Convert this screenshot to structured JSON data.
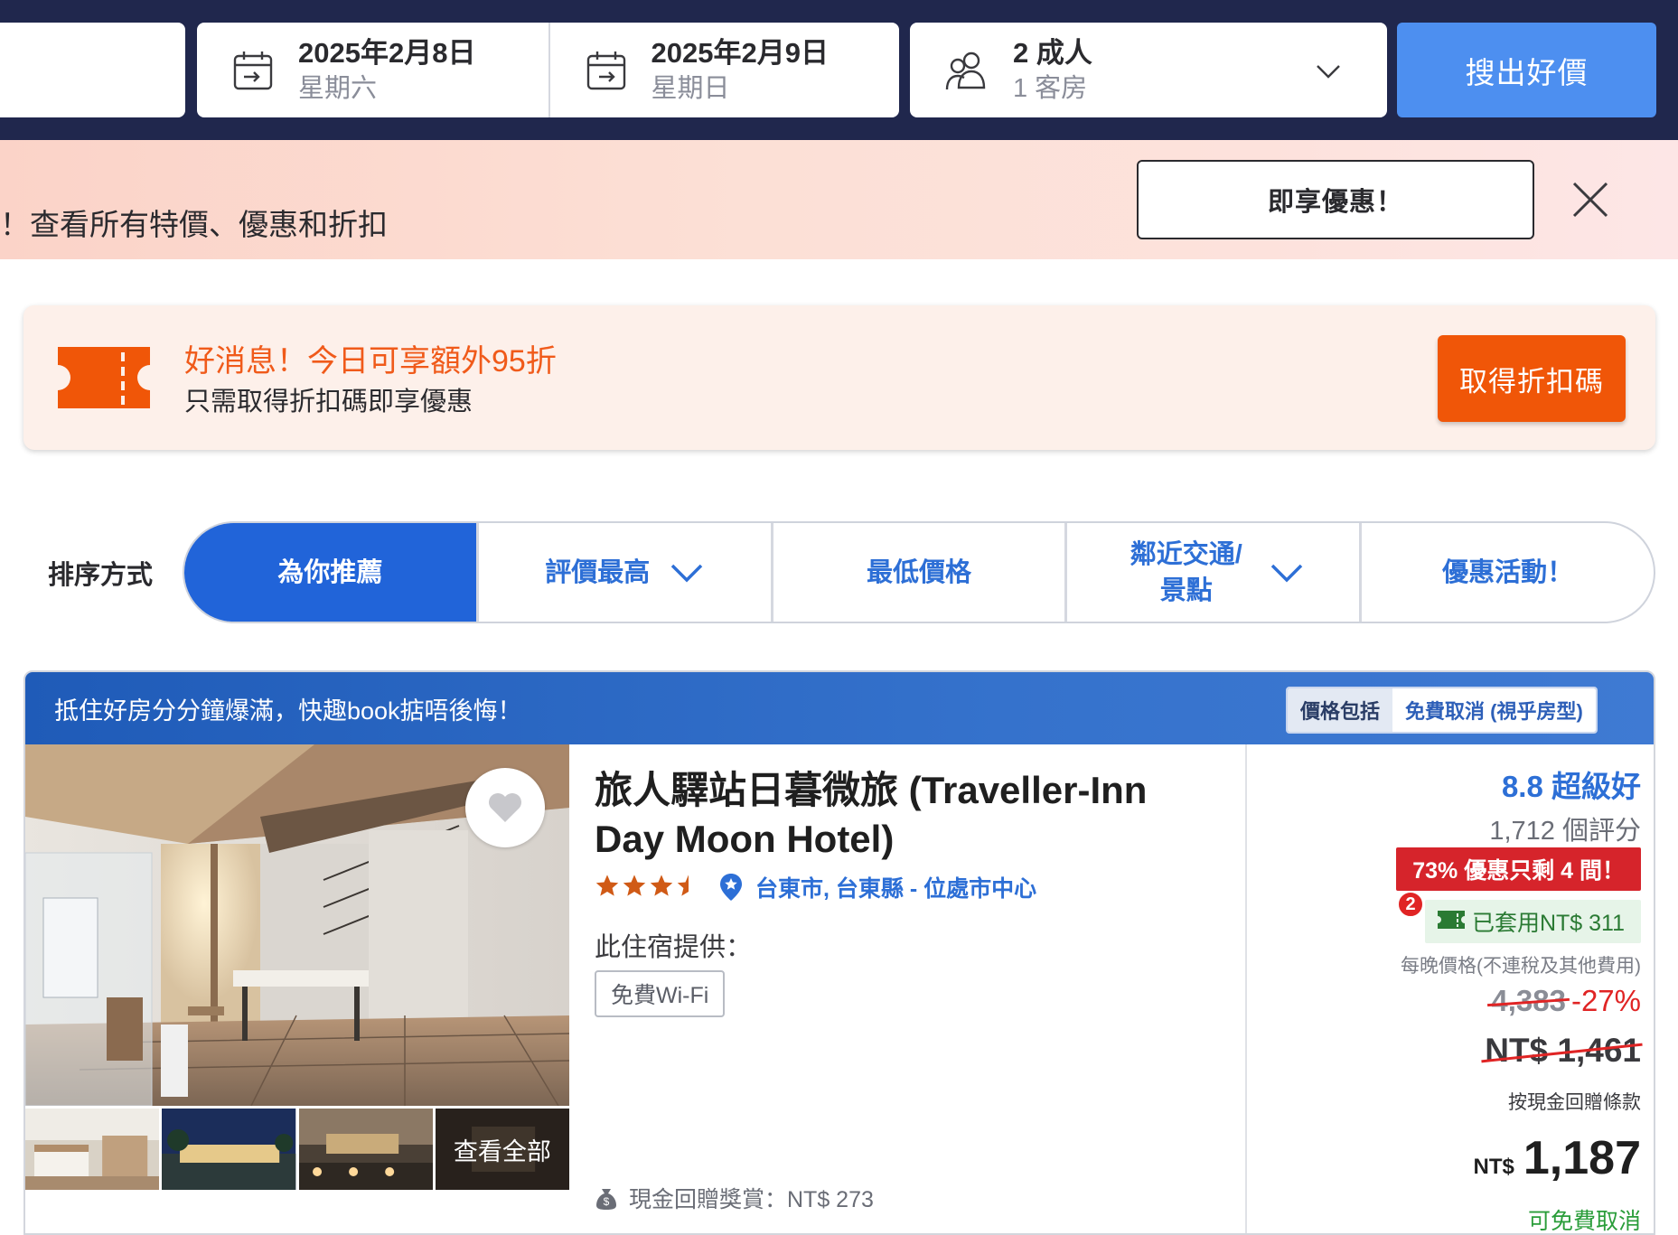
{
  "search": {
    "checkin": {
      "date": "2025年2月8日",
      "weekday": "星期六"
    },
    "checkout": {
      "date": "2025年2月9日",
      "weekday": "星期日"
    },
    "guests": {
      "adults": "2 成人",
      "rooms": "1 客房"
    },
    "search_button": "搜出好價"
  },
  "promo_banner": {
    "text": "！查看所有特價、優惠和折扣",
    "button": "即享優惠！"
  },
  "discount_card": {
    "title": "好消息！今日可享額外95折",
    "subtitle": "只需取得折扣碼即享優惠",
    "button": "取得折扣碼"
  },
  "sort": {
    "label": "排序方式",
    "tabs": [
      {
        "label": "為你推薦",
        "active": true
      },
      {
        "label": "評價最高"
      },
      {
        "label": "最低價格"
      },
      {
        "label": "鄰近交通/景點"
      },
      {
        "label": "優惠活動！"
      }
    ]
  },
  "hotel": {
    "urgency_header": "抵住好房分分鐘爆滿，快趣book掂唔後悔！",
    "price_includes_label": "價格包括",
    "price_includes_value": "免費取消 (視乎房型)",
    "name": "旅人驛站日暮微旅 (Traveller-Inn Day Moon Hotel)",
    "stars": 3.5,
    "location": "台東市, 台東縣 - 位處市中心",
    "offers_label": "此住宿提供：",
    "amenity": "免費Wi-Fi",
    "see_all": "查看全部",
    "cashback": "現金回贈獎賞：NT$ 273",
    "score": "8.8 超級好",
    "reviews": "1,712 個評分",
    "urgent_badge": "73% 優惠只剩 4 間！",
    "step_badge": "2",
    "applied_coupon": "已套用NT$ 311",
    "per_night_note": "每晚價格(不連稅及其他費用)",
    "original_price": "4,383",
    "discount_pct": "-27%",
    "strike_price": "NT$ 1,461",
    "cashback_terms": "按現金回贈條款",
    "final_currency": "NT$",
    "final_price": "1,187",
    "free_cancel": "可免費取消"
  },
  "colors": {
    "header_bg": "#20274d",
    "search_button": "#4d8ff0",
    "accent_orange": "#f05608",
    "primary_blue": "#2164d9",
    "alert_red": "#d6242b",
    "success_green": "#2a9d3a"
  }
}
